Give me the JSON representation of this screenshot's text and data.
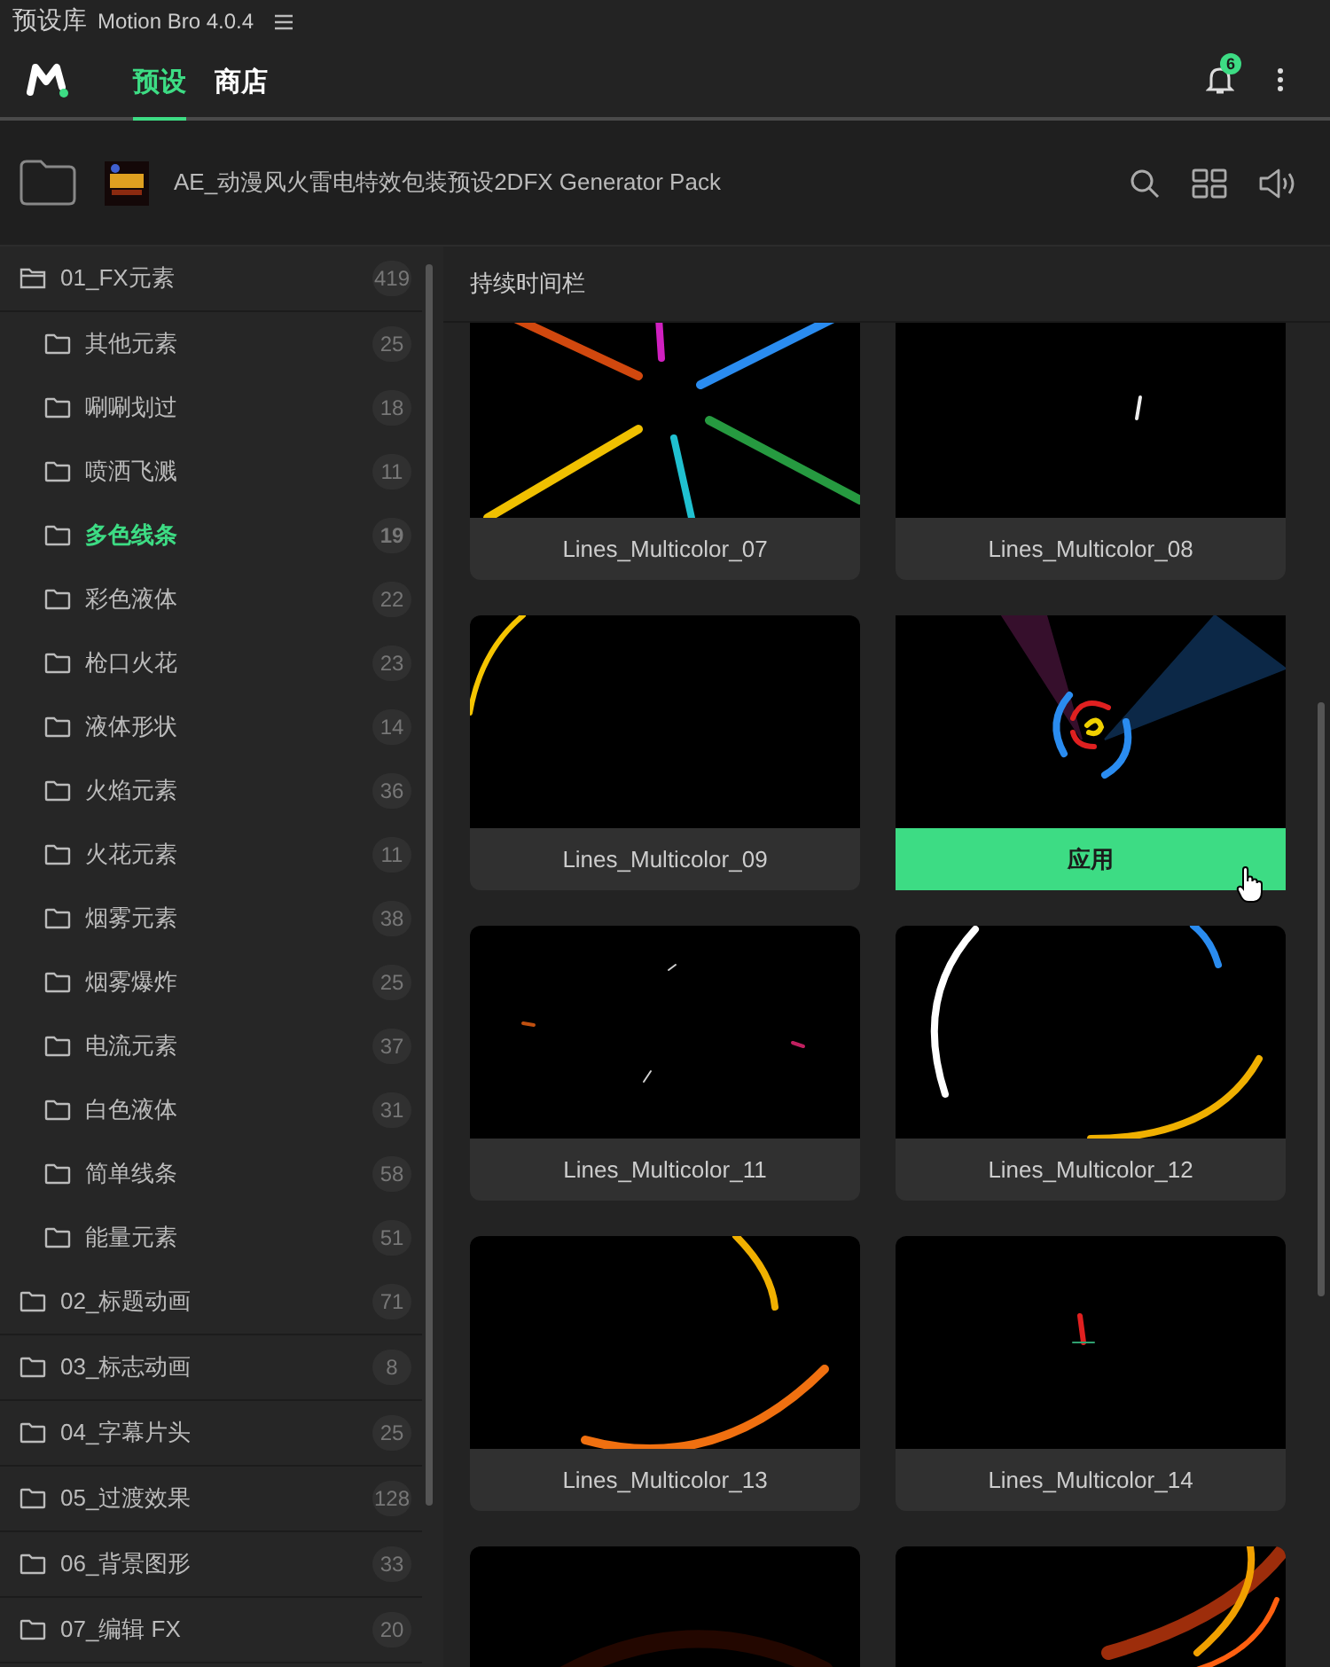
{
  "app": {
    "title": "预设库",
    "version": "Motion Bro 4.0.4"
  },
  "nav": {
    "tabs": [
      {
        "label": "预设",
        "selected": true
      },
      {
        "label": "商店",
        "selected": false
      }
    ],
    "notifications": "6"
  },
  "pack": {
    "title": "AE_动漫风火雷电特效包装预设2DFX Generator Pack"
  },
  "sidebar": {
    "folders": [
      {
        "name": "01_FX元素",
        "count": "419",
        "expanded": true,
        "selected": false,
        "children": [
          {
            "name": "其他元素",
            "count": "25",
            "selected": false
          },
          {
            "name": "唰唰划过",
            "count": "18",
            "selected": false
          },
          {
            "name": "喷洒飞溅",
            "count": "11",
            "selected": false
          },
          {
            "name": "多色线条",
            "count": "19",
            "selected": true
          },
          {
            "name": "彩色液体",
            "count": "22",
            "selected": false
          },
          {
            "name": "枪口火花",
            "count": "23",
            "selected": false
          },
          {
            "name": "液体形状",
            "count": "14",
            "selected": false
          },
          {
            "name": "火焰元素",
            "count": "36",
            "selected": false
          },
          {
            "name": "火花元素",
            "count": "11",
            "selected": false
          },
          {
            "name": "烟雾元素",
            "count": "38",
            "selected": false
          },
          {
            "name": "烟雾爆炸",
            "count": "25",
            "selected": false
          },
          {
            "name": "电流元素",
            "count": "37",
            "selected": false
          },
          {
            "name": "白色液体",
            "count": "31",
            "selected": false
          },
          {
            "name": "简单线条",
            "count": "58",
            "selected": false
          },
          {
            "name": "能量元素",
            "count": "51",
            "selected": false
          }
        ]
      },
      {
        "name": "02_标题动画",
        "count": "71",
        "expanded": false,
        "selected": false
      },
      {
        "name": "03_标志动画",
        "count": "8",
        "expanded": false,
        "selected": false
      },
      {
        "name": "04_字幕片头",
        "count": "25",
        "expanded": false,
        "selected": false
      },
      {
        "name": "05_过渡效果",
        "count": "128",
        "expanded": false,
        "selected": false
      },
      {
        "name": "06_背景图形",
        "count": "33",
        "expanded": false,
        "selected": false
      },
      {
        "name": "07_编辑 FX",
        "count": "20",
        "expanded": false,
        "selected": false
      }
    ]
  },
  "content": {
    "section_title": "持续时间栏",
    "presets": [
      {
        "name": "Lines_Multicolor_07",
        "hovered": false
      },
      {
        "name": "Lines_Multicolor_08",
        "hovered": false
      },
      {
        "name": "Lines_Multicolor_09",
        "hovered": false
      },
      {
        "hovered": true,
        "action": "应用"
      },
      {
        "name": "Lines_Multicolor_11",
        "hovered": false
      },
      {
        "name": "Lines_Multicolor_12",
        "hovered": false
      },
      {
        "name": "Lines_Multicolor_13",
        "hovered": false
      },
      {
        "name": "Lines_Multicolor_14",
        "hovered": false
      },
      {
        "hovered": false
      },
      {
        "hovered": false
      }
    ]
  }
}
